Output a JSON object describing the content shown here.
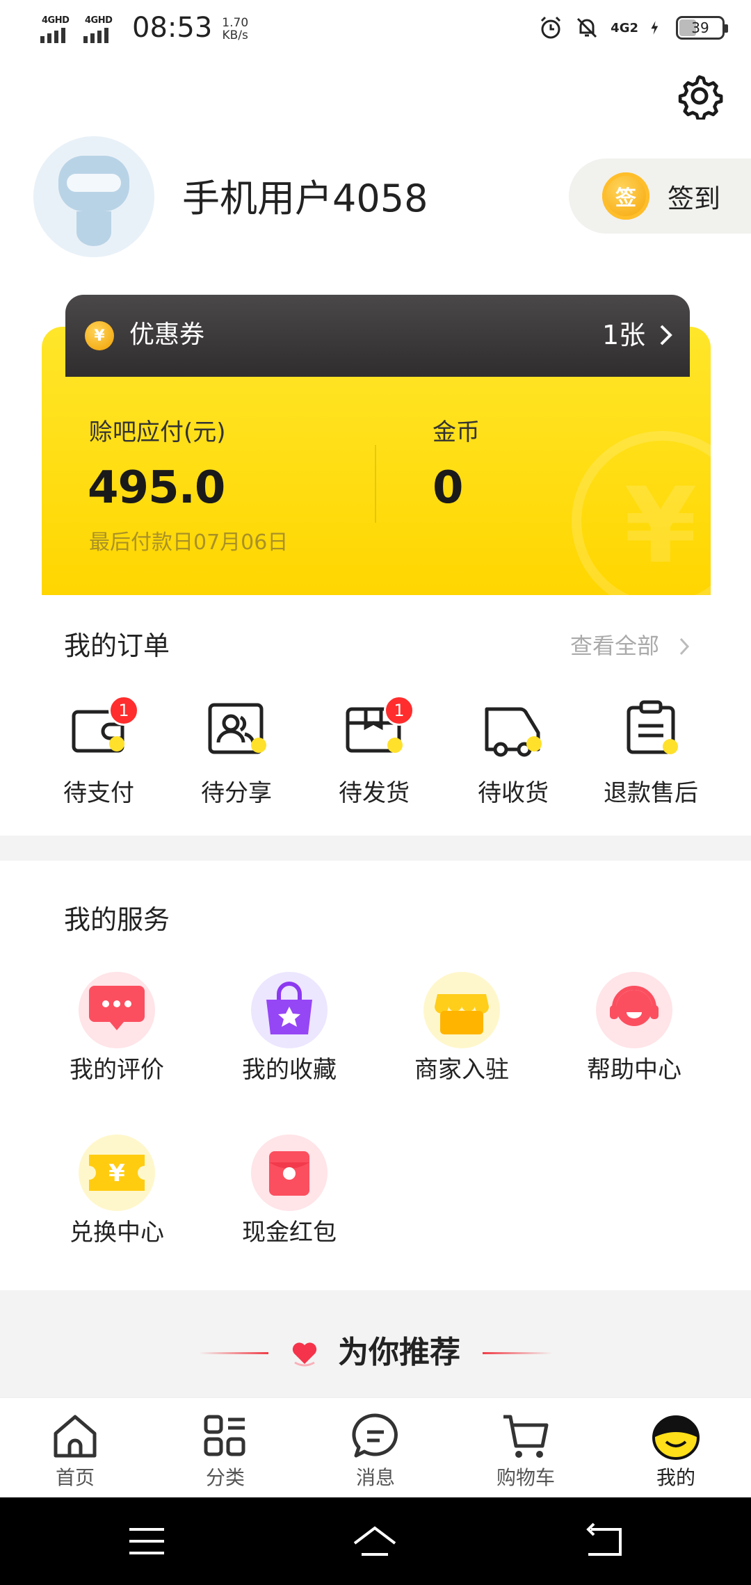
{
  "status_bar": {
    "network_1": "4GHD",
    "network_2": "4GHD",
    "time": "08:53",
    "speed_value": "1.70",
    "speed_unit": "KB/s",
    "network_right": "4G2",
    "battery": "39"
  },
  "profile": {
    "username": "手机用户4058",
    "signin_icon_text": "签",
    "signin_label": "签到"
  },
  "coupon": {
    "icon_text": "¥",
    "title": "优惠券",
    "count": "1张"
  },
  "account": {
    "payable_label": "赊吧应付(元)",
    "payable_value": "495.0",
    "due_date": "最后付款日07月06日",
    "coins_label": "金币",
    "coins_value": "0"
  },
  "orders": {
    "title": "我的订单",
    "view_all": "查看全部",
    "items": [
      {
        "label": "待支付",
        "badge": "1",
        "icon": "wallet-icon"
      },
      {
        "label": "待分享",
        "badge": "",
        "icon": "share-users-icon"
      },
      {
        "label": "待发货",
        "badge": "1",
        "icon": "package-icon"
      },
      {
        "label": "待收货",
        "badge": "",
        "icon": "truck-icon"
      },
      {
        "label": "退款售后",
        "badge": "",
        "icon": "clipboard-icon"
      }
    ]
  },
  "services": {
    "title": "我的服务",
    "items": [
      {
        "label": "我的评价",
        "icon": "comment-icon"
      },
      {
        "label": "我的收藏",
        "icon": "bag-star-icon"
      },
      {
        "label": "商家入驻",
        "icon": "shop-icon"
      },
      {
        "label": "帮助中心",
        "icon": "headset-icon"
      },
      {
        "label": "兑换中心",
        "icon": "ticket-icon"
      },
      {
        "label": "现金红包",
        "icon": "red-envelope-icon"
      }
    ]
  },
  "recommend": {
    "title": "为你推荐"
  },
  "tabs": [
    {
      "label": "首页",
      "icon": "home-icon"
    },
    {
      "label": "分类",
      "icon": "category-icon"
    },
    {
      "label": "消息",
      "icon": "message-icon"
    },
    {
      "label": "购物车",
      "icon": "cart-icon"
    },
    {
      "label": "我的",
      "icon": "smiley-icon",
      "active": true
    }
  ],
  "colors": {
    "accent_yellow": "#FFDD11",
    "badge_red": "#FF2D2D",
    "coupon_bar": "#3A3839"
  }
}
